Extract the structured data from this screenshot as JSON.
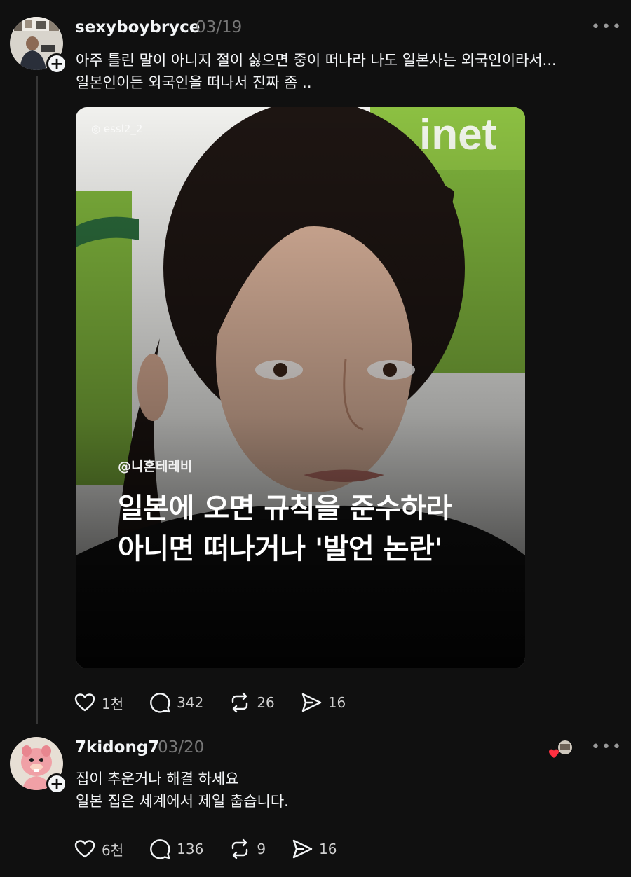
{
  "posts": [
    {
      "username": "sexyboybryce",
      "date": "03/19",
      "text_lines": [
        "아주 틀린 말이 아니지 절이 싫으면 중이 떠나라 나도 일본사는 외국인이라서...",
        "일본인이든 외국인을 떠나서 진짜 좀 .."
      ],
      "media": {
        "watermark": "essl2_2",
        "source": "@니혼테레비",
        "caption_lines": [
          "일본에 오면 규칙을 준수하라",
          "아니면 떠나거나 '발언 논란'"
        ],
        "background_sign_text": "inet"
      },
      "actions": {
        "likes": "1천",
        "comments": "342",
        "reposts": "26",
        "shares": "16"
      }
    },
    {
      "username": "7kidong7",
      "date": "03/20",
      "text_lines": [
        "집이 추운거나 해결 하세요",
        "일본 집은 세계에서 제일 춥습니다."
      ],
      "actions": {
        "likes": "6천",
        "comments": "136",
        "reposts": "9",
        "shares": "16"
      }
    }
  ],
  "icons": {
    "like": "heart-icon",
    "comment": "comment-bubble-icon",
    "repost": "repost-arrows-icon",
    "share": "send-arrow-icon",
    "more": "more-dots-icon",
    "follow": "plus-icon"
  },
  "colors": {
    "background": "#101010",
    "text": "#f3f5f7",
    "muted": "#777777",
    "liked_heart": "#ff3040"
  }
}
